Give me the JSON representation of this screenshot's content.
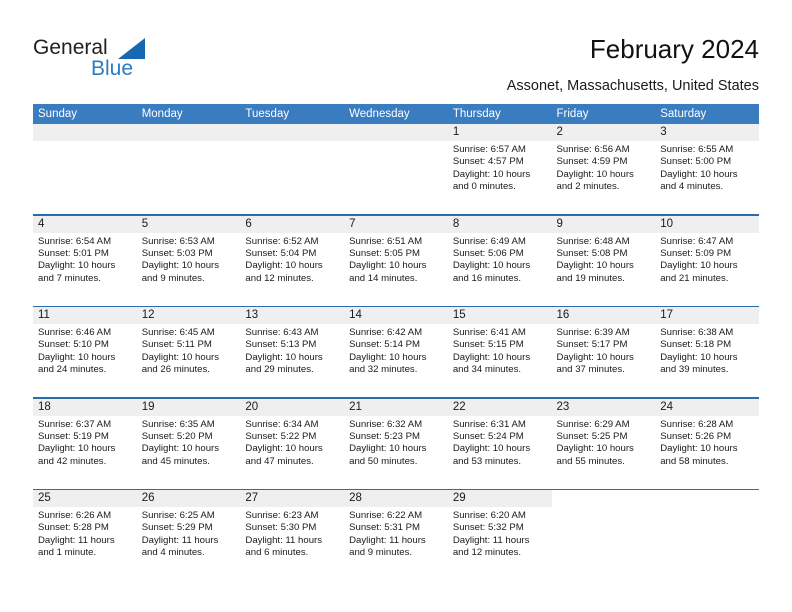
{
  "logo": {
    "text_primary": "General",
    "text_secondary": "Blue",
    "triangle_color": "#1668b3",
    "secondary_color": "#2e7bc4"
  },
  "header": {
    "title": "February 2024",
    "subtitle": "Assonet, Massachusetts, United States"
  },
  "theme": {
    "header_band": "#3a7cc0",
    "rule": "#2b6cab",
    "number_band": "#efefef",
    "text": "#1a1a1a"
  },
  "weekdays": [
    "Sunday",
    "Monday",
    "Tuesday",
    "Wednesday",
    "Thursday",
    "Friday",
    "Saturday"
  ],
  "weeks": [
    {
      "days": [
        {
          "num": "",
          "sunrise": "",
          "sunset": "",
          "daylight_1": "",
          "daylight_2": ""
        },
        {
          "num": "",
          "sunrise": "",
          "sunset": "",
          "daylight_1": "",
          "daylight_2": ""
        },
        {
          "num": "",
          "sunrise": "",
          "sunset": "",
          "daylight_1": "",
          "daylight_2": ""
        },
        {
          "num": "",
          "sunrise": "",
          "sunset": "",
          "daylight_1": "",
          "daylight_2": ""
        },
        {
          "num": "1",
          "sunrise": "Sunrise: 6:57 AM",
          "sunset": "Sunset: 4:57 PM",
          "daylight_1": "Daylight: 10 hours",
          "daylight_2": "and 0 minutes."
        },
        {
          "num": "2",
          "sunrise": "Sunrise: 6:56 AM",
          "sunset": "Sunset: 4:59 PM",
          "daylight_1": "Daylight: 10 hours",
          "daylight_2": "and 2 minutes."
        },
        {
          "num": "3",
          "sunrise": "Sunrise: 6:55 AM",
          "sunset": "Sunset: 5:00 PM",
          "daylight_1": "Daylight: 10 hours",
          "daylight_2": "and 4 minutes."
        }
      ]
    },
    {
      "days": [
        {
          "num": "4",
          "sunrise": "Sunrise: 6:54 AM",
          "sunset": "Sunset: 5:01 PM",
          "daylight_1": "Daylight: 10 hours",
          "daylight_2": "and 7 minutes."
        },
        {
          "num": "5",
          "sunrise": "Sunrise: 6:53 AM",
          "sunset": "Sunset: 5:03 PM",
          "daylight_1": "Daylight: 10 hours",
          "daylight_2": "and 9 minutes."
        },
        {
          "num": "6",
          "sunrise": "Sunrise: 6:52 AM",
          "sunset": "Sunset: 5:04 PM",
          "daylight_1": "Daylight: 10 hours",
          "daylight_2": "and 12 minutes."
        },
        {
          "num": "7",
          "sunrise": "Sunrise: 6:51 AM",
          "sunset": "Sunset: 5:05 PM",
          "daylight_1": "Daylight: 10 hours",
          "daylight_2": "and 14 minutes."
        },
        {
          "num": "8",
          "sunrise": "Sunrise: 6:49 AM",
          "sunset": "Sunset: 5:06 PM",
          "daylight_1": "Daylight: 10 hours",
          "daylight_2": "and 16 minutes."
        },
        {
          "num": "9",
          "sunrise": "Sunrise: 6:48 AM",
          "sunset": "Sunset: 5:08 PM",
          "daylight_1": "Daylight: 10 hours",
          "daylight_2": "and 19 minutes."
        },
        {
          "num": "10",
          "sunrise": "Sunrise: 6:47 AM",
          "sunset": "Sunset: 5:09 PM",
          "daylight_1": "Daylight: 10 hours",
          "daylight_2": "and 21 minutes."
        }
      ]
    },
    {
      "days": [
        {
          "num": "11",
          "sunrise": "Sunrise: 6:46 AM",
          "sunset": "Sunset: 5:10 PM",
          "daylight_1": "Daylight: 10 hours",
          "daylight_2": "and 24 minutes."
        },
        {
          "num": "12",
          "sunrise": "Sunrise: 6:45 AM",
          "sunset": "Sunset: 5:11 PM",
          "daylight_1": "Daylight: 10 hours",
          "daylight_2": "and 26 minutes."
        },
        {
          "num": "13",
          "sunrise": "Sunrise: 6:43 AM",
          "sunset": "Sunset: 5:13 PM",
          "daylight_1": "Daylight: 10 hours",
          "daylight_2": "and 29 minutes."
        },
        {
          "num": "14",
          "sunrise": "Sunrise: 6:42 AM",
          "sunset": "Sunset: 5:14 PM",
          "daylight_1": "Daylight: 10 hours",
          "daylight_2": "and 32 minutes."
        },
        {
          "num": "15",
          "sunrise": "Sunrise: 6:41 AM",
          "sunset": "Sunset: 5:15 PM",
          "daylight_1": "Daylight: 10 hours",
          "daylight_2": "and 34 minutes."
        },
        {
          "num": "16",
          "sunrise": "Sunrise: 6:39 AM",
          "sunset": "Sunset: 5:17 PM",
          "daylight_1": "Daylight: 10 hours",
          "daylight_2": "and 37 minutes."
        },
        {
          "num": "17",
          "sunrise": "Sunrise: 6:38 AM",
          "sunset": "Sunset: 5:18 PM",
          "daylight_1": "Daylight: 10 hours",
          "daylight_2": "and 39 minutes."
        }
      ]
    },
    {
      "days": [
        {
          "num": "18",
          "sunrise": "Sunrise: 6:37 AM",
          "sunset": "Sunset: 5:19 PM",
          "daylight_1": "Daylight: 10 hours",
          "daylight_2": "and 42 minutes."
        },
        {
          "num": "19",
          "sunrise": "Sunrise: 6:35 AM",
          "sunset": "Sunset: 5:20 PM",
          "daylight_1": "Daylight: 10 hours",
          "daylight_2": "and 45 minutes."
        },
        {
          "num": "20",
          "sunrise": "Sunrise: 6:34 AM",
          "sunset": "Sunset: 5:22 PM",
          "daylight_1": "Daylight: 10 hours",
          "daylight_2": "and 47 minutes."
        },
        {
          "num": "21",
          "sunrise": "Sunrise: 6:32 AM",
          "sunset": "Sunset: 5:23 PM",
          "daylight_1": "Daylight: 10 hours",
          "daylight_2": "and 50 minutes."
        },
        {
          "num": "22",
          "sunrise": "Sunrise: 6:31 AM",
          "sunset": "Sunset: 5:24 PM",
          "daylight_1": "Daylight: 10 hours",
          "daylight_2": "and 53 minutes."
        },
        {
          "num": "23",
          "sunrise": "Sunrise: 6:29 AM",
          "sunset": "Sunset: 5:25 PM",
          "daylight_1": "Daylight: 10 hours",
          "daylight_2": "and 55 minutes."
        },
        {
          "num": "24",
          "sunrise": "Sunrise: 6:28 AM",
          "sunset": "Sunset: 5:26 PM",
          "daylight_1": "Daylight: 10 hours",
          "daylight_2": "and 58 minutes."
        }
      ]
    },
    {
      "days": [
        {
          "num": "25",
          "sunrise": "Sunrise: 6:26 AM",
          "sunset": "Sunset: 5:28 PM",
          "daylight_1": "Daylight: 11 hours",
          "daylight_2": "and 1 minute."
        },
        {
          "num": "26",
          "sunrise": "Sunrise: 6:25 AM",
          "sunset": "Sunset: 5:29 PM",
          "daylight_1": "Daylight: 11 hours",
          "daylight_2": "and 4 minutes."
        },
        {
          "num": "27",
          "sunrise": "Sunrise: 6:23 AM",
          "sunset": "Sunset: 5:30 PM",
          "daylight_1": "Daylight: 11 hours",
          "daylight_2": "and 6 minutes."
        },
        {
          "num": "28",
          "sunrise": "Sunrise: 6:22 AM",
          "sunset": "Sunset: 5:31 PM",
          "daylight_1": "Daylight: 11 hours",
          "daylight_2": "and 9 minutes."
        },
        {
          "num": "29",
          "sunrise": "Sunrise: 6:20 AM",
          "sunset": "Sunset: 5:32 PM",
          "daylight_1": "Daylight: 11 hours",
          "daylight_2": "and 12 minutes."
        },
        {
          "num": "",
          "sunrise": "",
          "sunset": "",
          "daylight_1": "",
          "daylight_2": ""
        },
        {
          "num": "",
          "sunrise": "",
          "sunset": "",
          "daylight_1": "",
          "daylight_2": ""
        }
      ]
    }
  ]
}
